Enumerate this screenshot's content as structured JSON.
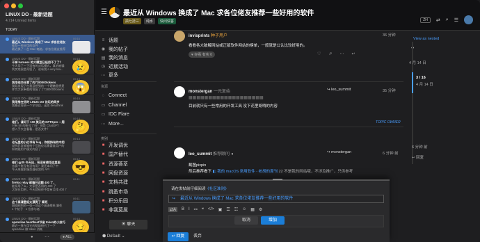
{
  "left_panel": {
    "title": "LINUX DO - 最新话题",
    "subtitle": "4,714 Unread Items",
    "section": "TODAY",
    "mails": [
      {
        "from": "LINUX DO - 最新话题",
        "subject": "最近从 Windows 换成了 Mac 求各位佬友",
        "line3": "推荐一些好用的软件",
        "line4": "最近换了一台 Mac 电脑，求各位佬友推荐",
        "time": "09:16",
        "selected": true,
        "thumb": "card"
      },
      {
        "from": "LINUX DO - 最新话题",
        "subject": "干掉 harness 的大模型已经用不了了？",
        "line3": "今天用了一下没有的对话模式，真的被骗",
        "line4": "到叉烧很是奇怪了。说有我 a very low...",
        "time": "09:16",
        "thumb": "sad"
      },
      {
        "from": "LINUX DO - 最新话题",
        "subject": "我用他交任意了约7280000tokens",
        "line3": "我既发现了在我没想到的一个硬糖是想是",
        "line4": "并为大家奉献的答复了了7280000tokens",
        "time": "09:15",
        "thumb": "shock"
      },
      {
        "from": "LINUX DO - 最新话题",
        "subject": "我用推在优时 LINUX DO 论坛的同步",
        "line3": "我最近在给一个学项目，出发 deepthink",
        "line4": "",
        "time": "09:15",
        "thumb": "shot"
      },
      {
        "from": "LINUX DO - 最新话题",
        "subject": "佬们，请问下 100 美元的 GPTSpro 一周",
        "line3": "只有 50 的账号了吗？他是 ChatGPT",
        "line4": "想入手大会看看，是否文件？",
        "time": "09:14",
        "thumb": "think"
      },
      {
        "from": "LINUX DO - 最新话题",
        "subject": "论坛里的小红书有 bug，你把持有的中用",
        "line3": "说明后发能够给个写的论坛需要谁用户的",
        "line4": "如何能用个模式内容了",
        "time": "09:13",
        "thumb": "dark"
      },
      {
        "from": "LINUX DO - 最新话题",
        "subject": "佬们 gpt5 今天出，有没有使用这里面",
        "line3": "去搞个账号有没有用？我还本问了中",
        "line4": "今天来搜索服务器给我的 API",
        "time": "09:12",
        "thumb": "cool"
      },
      {
        "from": "LINUX DO - 最新话题",
        "subject": "firefox relay 邮箱已达额 400 了，",
        "line3": "能扣用了么，大家是否用的 400 了",
        "line4": "之前在用吧，今天就给终不是有点找 400 7",
        "time": "09:11",
        "thumb": "none"
      },
      {
        "from": "LINUX DO - 最新话题",
        "subject": "这个高清壁纸太漂亮了 算死",
        "line3": "刚刚刷到的一张一项这个高清壁纸 算死",
        "line4": "1 个帖子 · 1 位参与者",
        "time": "09:11",
        "thumb": "wall"
      },
      {
        "from": "LINUX DO - 最新话题",
        "subject": "opencliae heartbeat节省 token的小技巧",
        "line3": "最近一直在用它的帮助研究了一下",
        "line4": "opencliae 做 token 消耗",
        "time": "09:10",
        "thumb": "smile"
      }
    ],
    "footer_all": "ALL"
  },
  "topic": {
    "title": "最近从 Windows 换成了 Mac 求各位佬友推荐一些好用的软件",
    "tags": [
      "搞七捻三",
      "纯水",
      "快问快答"
    ],
    "lang": "ZH"
  },
  "sidebar": {
    "items": [
      {
        "icon": "≡",
        "label": "话题"
      },
      {
        "icon": "◉",
        "label": "我的帖子"
      },
      {
        "icon": "▤",
        "label": "我的消息"
      },
      {
        "icon": "◷",
        "label": "近期活动"
      },
      {
        "icon": "⋯",
        "label": "更多"
      }
    ],
    "resources_title": "资源",
    "resources": [
      {
        "icon": "◌",
        "label": "Connect"
      },
      {
        "icon": "▭",
        "label": "Channel"
      },
      {
        "icon": "▭",
        "label": "IDC Flare"
      },
      {
        "icon": "⋯",
        "label": "More..."
      }
    ],
    "categories_title": "类别",
    "categories": [
      {
        "icon": "■",
        "label": "开发调优"
      },
      {
        "icon": "■",
        "label": "国产替代"
      },
      {
        "icon": "■",
        "label": "资源荟萃"
      },
      {
        "icon": "■",
        "label": "网盘资源"
      },
      {
        "icon": "■",
        "label": "文档共建"
      },
      {
        "icon": "■",
        "label": "跳蚤市场"
      },
      {
        "icon": "■",
        "label": "积分乐园"
      },
      {
        "icon": "■",
        "label": "非我莫属"
      }
    ],
    "chat_label": "聊天",
    "default_label": "Default"
  },
  "posts": [
    {
      "user": "invisprints",
      "user_title": "种子用户",
      "time": "36 分钟",
      "body": "看看各大破解网站或正版软件网站的榜单，一般就是公认比较好用的。",
      "reaction": "好看 有实",
      "reaction_count": "6"
    },
    {
      "user": "monstergan",
      "user_title": "一元复始",
      "reply_to": "leo_summit",
      "time": "35 分钟",
      "body": "目前就只有一些常用的开发工具 没下花里胡哨的内容",
      "note": "TOPIC OWNER"
    },
    {
      "user": "leo_summit",
      "user_title": "推荐顾问",
      "reply_to": "monstergan",
      "time": "6 分钟 前",
      "body1": "截图pixpin",
      "body2_pre": "然后推荐看下",
      "body2_link": "我的 macOS 常用软件 - 老胡的周刊",
      "body2_post": "22 不是我的网站哦，不涉及推广，只供参考"
    }
  ],
  "right": {
    "view_as_nested": "View as nested",
    "date_top": "4 月 14 日",
    "progress": "3 / 16",
    "progress_date": "4 月 14 日",
    "time_ago": "6 分钟 前",
    "reply_btn": "回复"
  },
  "composer": {
    "note_prefix": "请在发帖前仔细阅读",
    "note_link": "《社区准则》",
    "title_value": "最近从 Windows 换成了 Mac 求各位佬友推荐一些好用的软件",
    "cancel": "取消",
    "add": "增加",
    "send": "回复",
    "cancel2": "丢弃"
  }
}
